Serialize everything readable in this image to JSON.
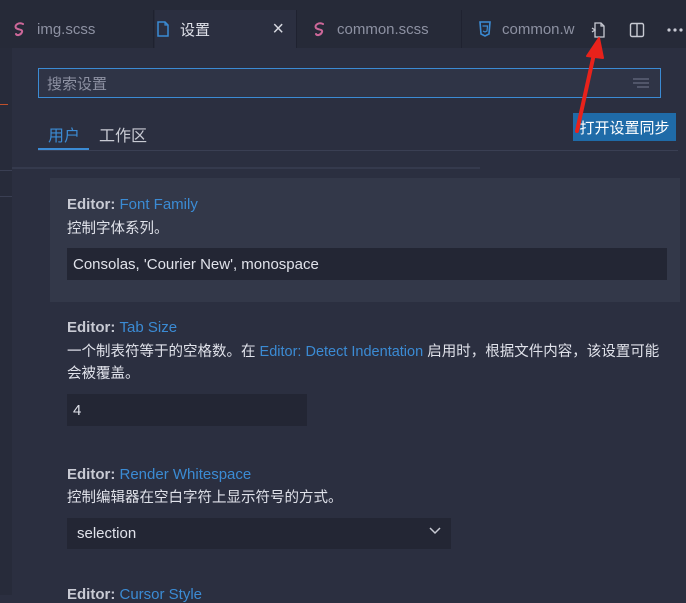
{
  "tabs": [
    {
      "label": "img.scss",
      "icon": "sass-icon"
    },
    {
      "label": "设置",
      "icon": "file-icon"
    },
    {
      "label": "common.scss",
      "icon": "sass-icon"
    },
    {
      "label": "common.w",
      "icon": "css-icon"
    }
  ],
  "tab_close_glyph": "×",
  "editor_actions": [
    "open-settings-json-icon",
    "split-editor-icon",
    "more-actions-icon"
  ],
  "search": {
    "placeholder": "搜索设置",
    "value": ""
  },
  "scopes": [
    "用户",
    "工作区"
  ],
  "sync_button": "打开设置同步",
  "settings": [
    {
      "category": "Editor: ",
      "key": "Font Family",
      "desc": "控制字体系列。",
      "value": "Consolas, 'Courier New', monospace"
    },
    {
      "category": "Editor: ",
      "key": "Tab Size",
      "desc_before": "一个制表符等于的空格数。在 ",
      "desc_link": "Editor: Detect Indentation",
      "desc_after": " 启用时，根据文件内容，该设置可能会被覆盖。",
      "value": "4"
    },
    {
      "category": "Editor: ",
      "key": "Render Whitespace",
      "desc": "控制编辑器在空白字符上显示符号的方式。",
      "value": "selection"
    },
    {
      "category": "Editor: ",
      "key": "Cursor Style"
    }
  ],
  "colors": {
    "accent": "#3b8bd4",
    "sync_button": "#1f6ba8",
    "annotation_arrow": "#e8221b",
    "sass": "#cd6799",
    "css": "#3b8bd4"
  }
}
